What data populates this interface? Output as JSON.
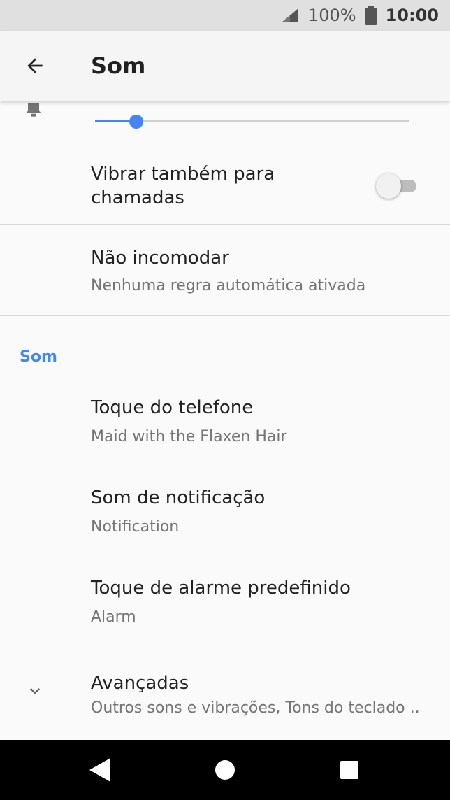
{
  "status_bar": {
    "signal_icon": "cell-signal-icon",
    "battery_percent": "100%",
    "battery_icon": "battery-icon",
    "time": "10:00"
  },
  "app_bar": {
    "back_icon": "arrow-back-icon",
    "title": "Som"
  },
  "ring_volume": {
    "icon": "bell-icon",
    "level": 0.13,
    "accent_color": "#4285f4"
  },
  "vibrate": {
    "label": "Vibrar também para chamadas",
    "enabled": false
  },
  "do_not_disturb": {
    "title": "Não incomodar",
    "summary": "Nenhuma regra automática ativada"
  },
  "sound_section": {
    "header": "Som",
    "items": [
      {
        "title": "Toque do telefone",
        "summary": "Maid with the Flaxen Hair"
      },
      {
        "title": "Som de notificação",
        "summary": "Notification"
      },
      {
        "title": "Toque de alarme predefinido",
        "summary": "Alarm"
      }
    ]
  },
  "advanced": {
    "icon": "chevron-down-icon",
    "title": "Avançadas",
    "summary": "Outros sons e vibrações, Tons do teclado .."
  },
  "nav_bar": {
    "back": "nav-back-icon",
    "home": "nav-home-icon",
    "recents": "nav-recents-icon"
  }
}
